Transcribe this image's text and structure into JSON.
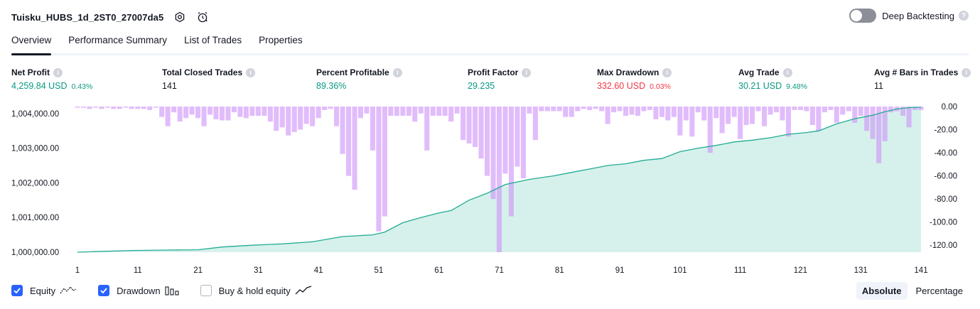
{
  "strategy_name": "Tuisku_HUBS_1d_2ST0_27007da5",
  "icons": {
    "settings": "gear-icon",
    "alert": "alarm-clock-icon"
  },
  "deep_backtesting": {
    "label": "Deep Backtesting",
    "enabled": false,
    "help": "?"
  },
  "tabs": [
    {
      "label": "Overview",
      "active": true
    },
    {
      "label": "Performance Summary",
      "active": false
    },
    {
      "label": "List of Trades",
      "active": false
    },
    {
      "label": "Properties",
      "active": false
    }
  ],
  "metrics": [
    {
      "label": "Net Profit",
      "value": "4,259.84 USD",
      "pct": "0.43%",
      "color": "green"
    },
    {
      "label": "Total Closed Trades",
      "value": "141",
      "pct": "",
      "color": "dark"
    },
    {
      "label": "Percent Profitable",
      "value": "89.36%",
      "pct": "",
      "color": "green"
    },
    {
      "label": "Profit Factor",
      "value": "29.235",
      "pct": "",
      "color": "green"
    },
    {
      "label": "Max Drawdown",
      "value": "332.60 USD",
      "pct": "0.03%",
      "color": "red"
    },
    {
      "label": "Avg Trade",
      "value": "30.21 USD",
      "pct": "9.48%",
      "color": "green"
    },
    {
      "label": "Avg # Bars in Trades",
      "value": "11",
      "pct": "",
      "color": "dark"
    }
  ],
  "info_glyph": "i",
  "legend": {
    "equity": {
      "label": "Equity",
      "checked": true
    },
    "drawdown": {
      "label": "Drawdown",
      "checked": true
    },
    "buyhold": {
      "label": "Buy & hold equity",
      "checked": false
    }
  },
  "scale": {
    "absolute": "Absolute",
    "percentage": "Percentage",
    "selected": "Absolute"
  },
  "colors": {
    "equity_line": "#22ab94",
    "equity_fill": "#cfeee7",
    "drawdown_bar": "#ce93f8",
    "accent": "#2962ff",
    "profit": "#089981",
    "loss": "#f23645"
  },
  "chart_data": {
    "type": "area",
    "x_ticks": [
      "1",
      "11",
      "21",
      "31",
      "41",
      "51",
      "61",
      "71",
      "81",
      "91",
      "101",
      "111",
      "121",
      "131",
      "141"
    ],
    "x_range": [
      1,
      141
    ],
    "left_axis": {
      "ticks": [
        "1,004,000.00",
        "1,003,000.00",
        "1,002,000.00",
        "1,001,000.00",
        "1,000,000.00"
      ],
      "ylim": [
        1000000,
        1004200
      ]
    },
    "right_axis": {
      "ticks": [
        "0.00",
        "-20.00",
        "-40.00",
        "-60.00",
        "-80.00",
        "-100.00",
        "-120.00"
      ],
      "ylim": [
        -126,
        0
      ]
    },
    "series": [
      {
        "name": "Equity",
        "type": "area",
        "points": [
          [
            1,
            1000000
          ],
          [
            10,
            1000050
          ],
          [
            15,
            1000060
          ],
          [
            21,
            1000070
          ],
          [
            25,
            1000150
          ],
          [
            30,
            1000200
          ],
          [
            35,
            1000240
          ],
          [
            40,
            1000300
          ],
          [
            45,
            1000450
          ],
          [
            48,
            1000480
          ],
          [
            50,
            1000500
          ],
          [
            52,
            1000580
          ],
          [
            55,
            1000850
          ],
          [
            58,
            1001000
          ],
          [
            61,
            1001130
          ],
          [
            63,
            1001200
          ],
          [
            66,
            1001500
          ],
          [
            69,
            1001700
          ],
          [
            72,
            1001950
          ],
          [
            76,
            1002100
          ],
          [
            80,
            1002200
          ],
          [
            83,
            1002300
          ],
          [
            86,
            1002400
          ],
          [
            89,
            1002500
          ],
          [
            92,
            1002550
          ],
          [
            95,
            1002650
          ],
          [
            98,
            1002700
          ],
          [
            101,
            1002900
          ],
          [
            104,
            1003000
          ],
          [
            107,
            1003080
          ],
          [
            110,
            1003180
          ],
          [
            113,
            1003230
          ],
          [
            116,
            1003300
          ],
          [
            119,
            1003400
          ],
          [
            122,
            1003450
          ],
          [
            124,
            1003500
          ],
          [
            127,
            1003700
          ],
          [
            130,
            1003850
          ],
          [
            133,
            1003950
          ],
          [
            135,
            1004050
          ],
          [
            137,
            1004130
          ],
          [
            139,
            1004170
          ],
          [
            141,
            1004180
          ]
        ]
      },
      {
        "name": "Drawdown",
        "type": "bar",
        "values": [
          -1,
          -1,
          -2,
          -1,
          -2,
          -1,
          -2,
          -2,
          -1,
          -2,
          -2,
          -2,
          -3,
          -1,
          -9,
          -17,
          -5,
          -13,
          -10,
          -7,
          -10,
          -17,
          -7,
          -11,
          -12,
          -12,
          -5,
          -9,
          -10,
          -8,
          -8,
          -8,
          -13,
          -21,
          -18,
          -25,
          -22,
          -20,
          -15,
          -17,
          -10,
          -3,
          -2,
          -17,
          -41,
          -60,
          -72,
          -10,
          -6,
          -38,
          -108,
          -95,
          -8,
          -8,
          -8,
          -8,
          -13,
          -6,
          -38,
          -8,
          -8,
          -8,
          -13,
          -6,
          -29,
          -32,
          -35,
          -45,
          -60,
          -80,
          -126,
          -58,
          -95,
          -52,
          -62,
          -6,
          -29,
          -4,
          -4,
          -4,
          -4,
          -9,
          -9,
          -4,
          -2,
          -3,
          -2,
          -4,
          -15,
          -5,
          -4,
          -8,
          -7,
          -8,
          -4,
          -3,
          -11,
          -9,
          -12,
          -9,
          -25,
          -12,
          -26,
          -5,
          -12,
          -40,
          -10,
          -23,
          -15,
          -9,
          -28,
          -16,
          -15,
          -4,
          -17,
          -7,
          -5,
          -12,
          -26,
          -3,
          -3,
          -4,
          -16,
          -21,
          -5,
          -3,
          -14,
          -7,
          -4,
          -14,
          -8,
          -21,
          -28,
          -49,
          -30,
          -5,
          -4,
          -8,
          -18,
          -3,
          -3
        ],
        "ylim": [
          -126,
          0
        ]
      }
    ],
    "grid": false,
    "legend_position": "bottom-left"
  }
}
